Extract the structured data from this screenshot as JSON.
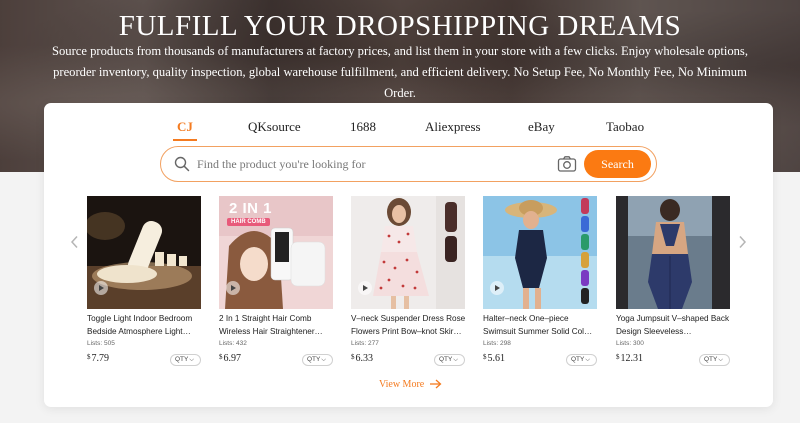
{
  "hero": {
    "title": "FULFILL YOUR DROPSHIPPING DREAMS",
    "description": "Source products from thousands of manufacturers at factory prices, and list them in your store with a few clicks. Enjoy wholesale options, preorder inventory, quality inspection, global warehouse fulfillment, and efficient delivery. No Setup Fee, No Monthly Fee, No Minimum Order."
  },
  "tabs": [
    {
      "label": "CJ",
      "active": true
    },
    {
      "label": "QKsource",
      "active": false
    },
    {
      "label": "1688",
      "active": false
    },
    {
      "label": "Aliexpress",
      "active": false
    },
    {
      "label": "eBay",
      "active": false
    },
    {
      "label": "Taobao",
      "active": false
    }
  ],
  "search": {
    "placeholder": "Find the product you're looking for",
    "value": "",
    "button_label": "Search",
    "search_icon": "search-icon",
    "camera_icon": "camera-icon"
  },
  "products": [
    {
      "name": "Toggle Light Indoor Bedroom Bedside Atmosphere Light…",
      "lists_label": "Lists:",
      "lists": "505",
      "currency": "$",
      "price": "7.79",
      "qty_label": "QTY"
    },
    {
      "name": "2 In 1 Straight Hair Comb Wireless Hair Straightener…",
      "lists_label": "Lists:",
      "lists": "432",
      "currency": "$",
      "price": "6.97",
      "qty_label": "QTY",
      "badge_top": "2 IN 1",
      "badge_sub": "HAIR COMB"
    },
    {
      "name": "V–neck Suspender Dress Rose Flowers Print Bow–knot Skir…",
      "lists_label": "Lists:",
      "lists": "277",
      "currency": "$",
      "price": "6.33",
      "qty_label": "QTY"
    },
    {
      "name": "Halter–neck One–piece Swimsuit Summer Solid Col…",
      "lists_label": "Lists:",
      "lists": "298",
      "currency": "$",
      "price": "5.61",
      "qty_label": "QTY"
    },
    {
      "name": "Yoga Jumpsuit V–shaped Back Design Sleeveless…",
      "lists_label": "Lists:",
      "lists": "300",
      "currency": "$",
      "price": "12.31",
      "qty_label": "QTY"
    }
  ],
  "view_more": "View More",
  "colors": {
    "accent": "#f47b20",
    "search_button": "#fb7a12",
    "search_border": "#f2a161"
  }
}
